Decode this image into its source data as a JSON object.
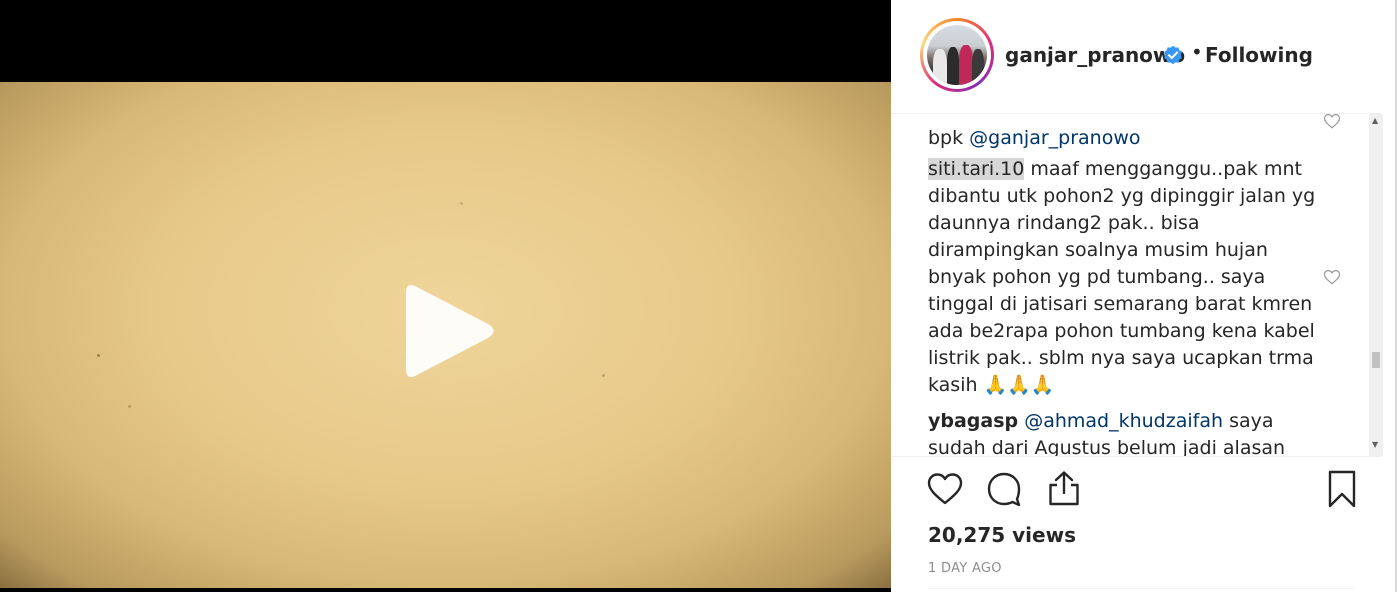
{
  "post": {
    "username": "ganjar_pranowo",
    "dot": "•",
    "follow_status": "Following"
  },
  "comments": {
    "partial_top": {
      "mention": "@ganjar_pranowo",
      "prefix": "bpk"
    },
    "items": [
      {
        "username": "siti.tari.10",
        "text": "maaf mengganggu..pak mnt dibantu utk pohon2 yg dipinggir jalan yg daunnya rindang2 pak.. bisa dirampingkan soalnya musim hujan bnyak pohon yg pd tumbang.. saya tinggal di jatisari semarang barat kmren ada be2rapa pohon tumbang kena kabel listrik pak.. sblm nya saya ucapkan trma kasih 🙏🙏🙏"
      },
      {
        "username": "ybagasp",
        "mention": "@ahmad_khudzaifah",
        "text": "saya sudah dari Agustus belum jadi alasan"
      }
    ]
  },
  "stats": {
    "views": "20,275 views",
    "age": "1 DAY AGO"
  },
  "icons": {
    "play": "play-icon",
    "like": "heart-icon",
    "comment": "comment-icon",
    "share": "share-icon",
    "save": "bookmark-icon",
    "verified": "verified-badge-icon"
  },
  "colors": {
    "mention": "#003569",
    "verified": "#3897f0",
    "text": "#262626",
    "muted": "#8e8e8e"
  }
}
